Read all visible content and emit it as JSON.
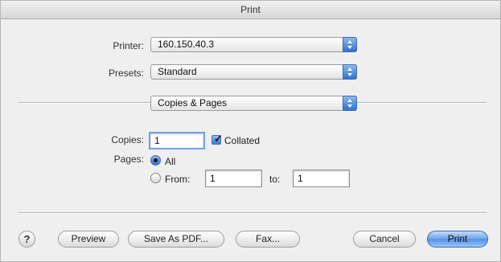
{
  "window": {
    "title": "Print"
  },
  "printer": {
    "label": "Printer:",
    "value": "160.150.40.3"
  },
  "presets": {
    "label": "Presets:",
    "value": "Standard"
  },
  "panel": {
    "value": "Copies & Pages"
  },
  "copies": {
    "label": "Copies:",
    "value": "1",
    "collated_label": "Collated",
    "collated": true
  },
  "pages": {
    "label": "Pages:",
    "all_label": "All",
    "from_label": "From:",
    "from_value": "1",
    "to_label": "to:",
    "to_value": "1",
    "selected": "All"
  },
  "buttons": {
    "help": "?",
    "preview": "Preview",
    "save_pdf": "Save As PDF...",
    "fax": "Fax...",
    "cancel": "Cancel",
    "print": "Print"
  },
  "colors": {
    "accent": "#3b78d2",
    "window_bg": "#efefef"
  }
}
